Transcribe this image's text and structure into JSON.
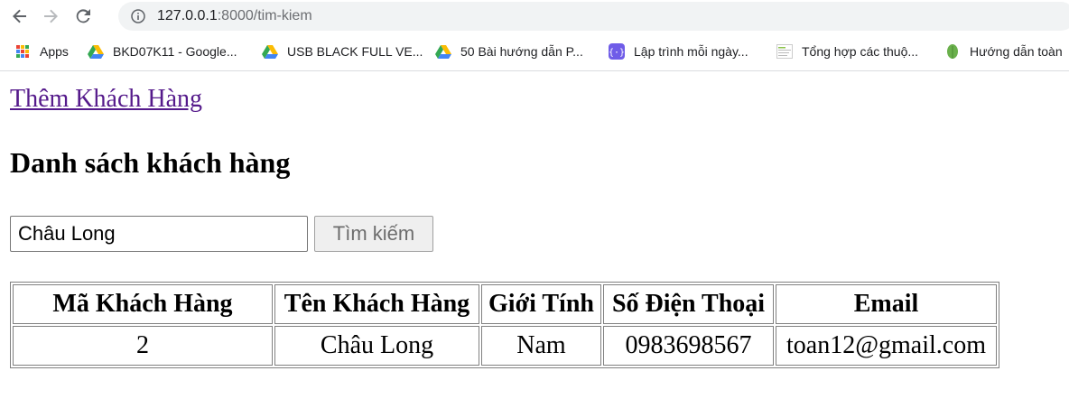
{
  "browser": {
    "url_host": "127.0.0.1",
    "url_path": ":8000/tim-kiem"
  },
  "bookmarks": [
    {
      "label": "Apps",
      "icon": "apps-grid-icon"
    },
    {
      "label": "BKD07K11 - Google...",
      "icon": "google-drive-icon"
    },
    {
      "label": "USB BLACK FULL VE...",
      "icon": "google-drive-icon"
    },
    {
      "label": "50 Bài hướng dẫn P...",
      "icon": "google-drive-icon"
    },
    {
      "label": "Lập trình mỗi ngày...",
      "icon": "code-brackets-icon"
    },
    {
      "label": "Tổng hợp các thuộ...",
      "icon": "webpage-thumbnail-icon"
    },
    {
      "label": "Hướng dẫn toàn",
      "icon": "leaf-icon"
    }
  ],
  "page": {
    "add_link": "Thêm Khách Hàng",
    "title": "Danh sách khách hàng",
    "search": {
      "value": "Châu Long",
      "button_label": "Tìm kiếm"
    },
    "table": {
      "headers": [
        "Mã Khách Hàng",
        "Tên Khách Hàng",
        "Giới Tính",
        "Số Điện Thoại",
        "Email"
      ],
      "rows": [
        [
          "2",
          "Châu Long",
          "Nam",
          "0983698567",
          "toan12@gmail.com"
        ]
      ]
    }
  }
}
